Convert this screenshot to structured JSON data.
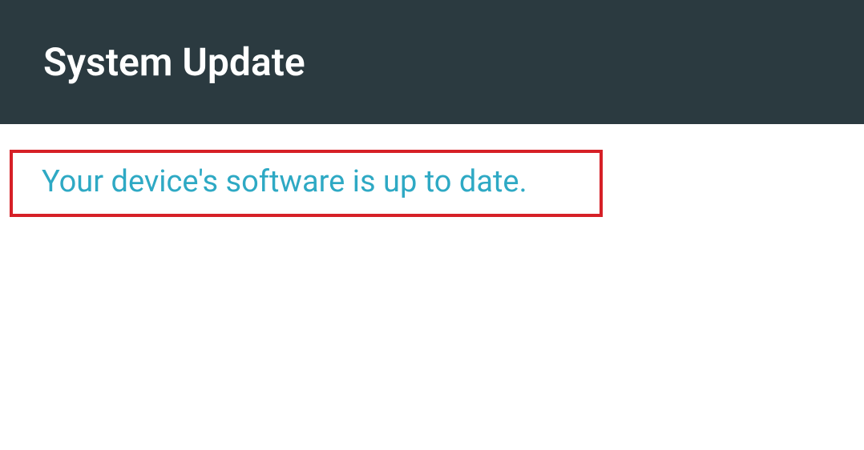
{
  "header": {
    "title": "System Update"
  },
  "status": {
    "message": "Your device's software is up to date."
  },
  "colors": {
    "header_bg": "#2b3a40",
    "accent": "#2ea9c4",
    "highlight_border": "#d62027"
  }
}
